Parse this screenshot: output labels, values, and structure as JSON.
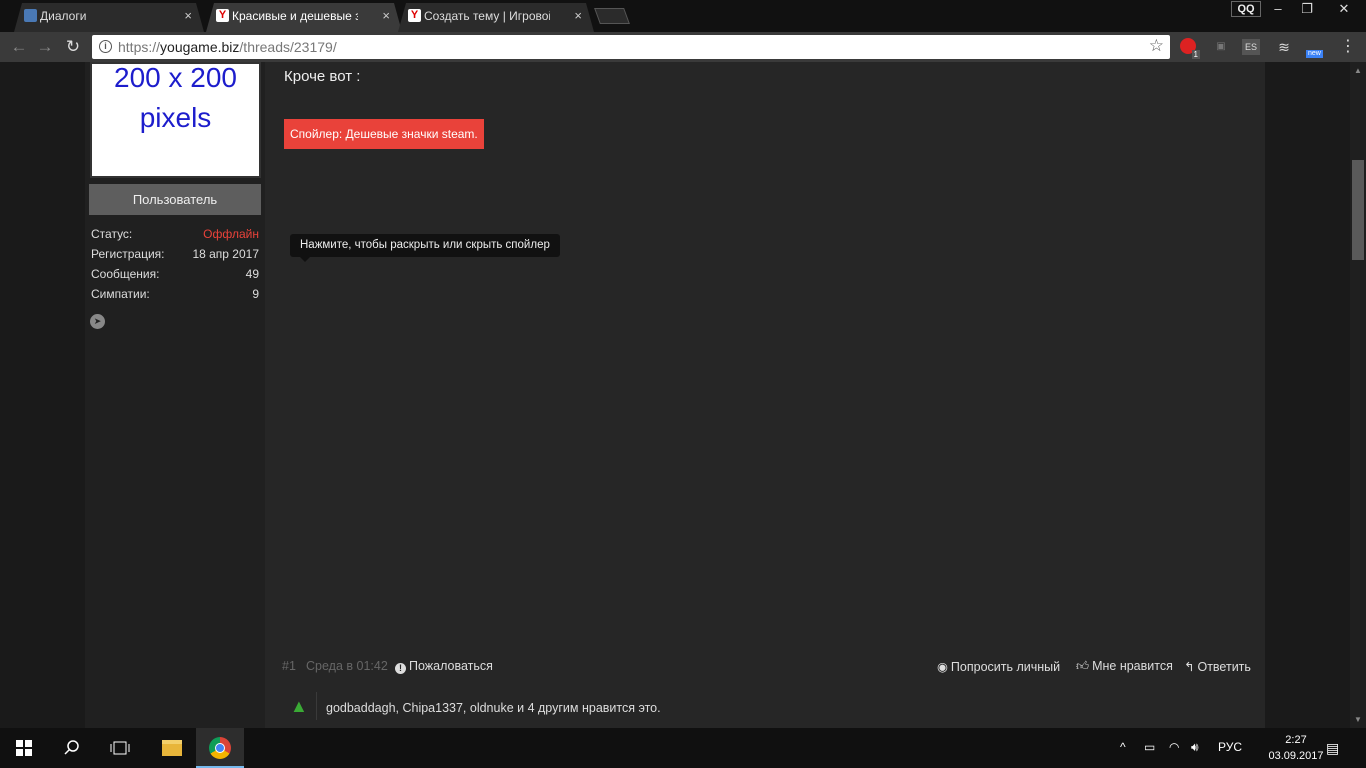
{
  "tabs": [
    {
      "title": "Диалоги",
      "favicon": "dialogs-icon"
    },
    {
      "title": "Красивые и дешевые зн",
      "favicon": "yougame-icon"
    },
    {
      "title": "Создать тему | Игровой",
      "favicon": "yougame-icon"
    }
  ],
  "tab_close": "×",
  "window": {
    "qq": "QQ",
    "minimize": "–",
    "restore": "❐",
    "close": "✕"
  },
  "address": {
    "scheme": "https://",
    "host": "yougame.biz",
    "path": "/threads/23179/"
  },
  "extensions": {
    "opera_badge": "1",
    "es": "ES",
    "new_badge": "new"
  },
  "user": {
    "avatar_line1": "200 x 200",
    "avatar_line2": "pixels",
    "title": "Пользователь",
    "stats": [
      {
        "label": "Статус:",
        "value": "Оффлайн"
      },
      {
        "label": "Регистрация:",
        "value": "18 апр 2017"
      },
      {
        "label": "Сообщения:",
        "value": "49"
      },
      {
        "label": "Симпатии:",
        "value": "9"
      }
    ]
  },
  "post": {
    "text": "Кроче вот :",
    "spoiler_button": "Спойлер: Дешевые значки steam.",
    "tooltip": "Нажмите, чтобы раскрыть или скрыть спойлер"
  },
  "footer": {
    "number": "#1",
    "date": "Среда в 01:42",
    "report": "Пожаловаться",
    "ask_private": "Попросить личный",
    "like": "Мне нравится",
    "reply": "Ответить"
  },
  "likes_text": "godbaddagh, Chipa1337, oldnuke и 4 другим нравится это.",
  "taskbar": {
    "lang": "РУС",
    "time": "2:27",
    "date": "03.09.2017"
  },
  "colors": {
    "accent_red": "#e9423a",
    "like_green": "#3aaa35"
  }
}
